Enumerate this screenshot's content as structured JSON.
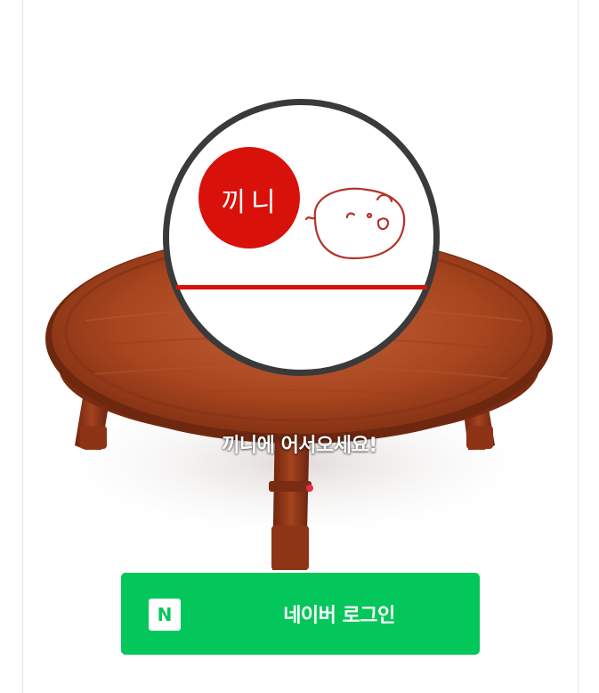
{
  "logo": {
    "brand_text": "끼니"
  },
  "welcome": {
    "message": "끼니에 어서오세요!"
  },
  "login": {
    "naver_badge": "N",
    "button_label": "네이버 로그인"
  },
  "colors": {
    "naver_green": "#03c75a",
    "logo_red": "#d9110b",
    "logo_ring": "#3a3a3a",
    "table_wood": "#a4431f"
  },
  "icons": {
    "logo": "pig-logo-icon",
    "naver": "naver-n-icon"
  }
}
